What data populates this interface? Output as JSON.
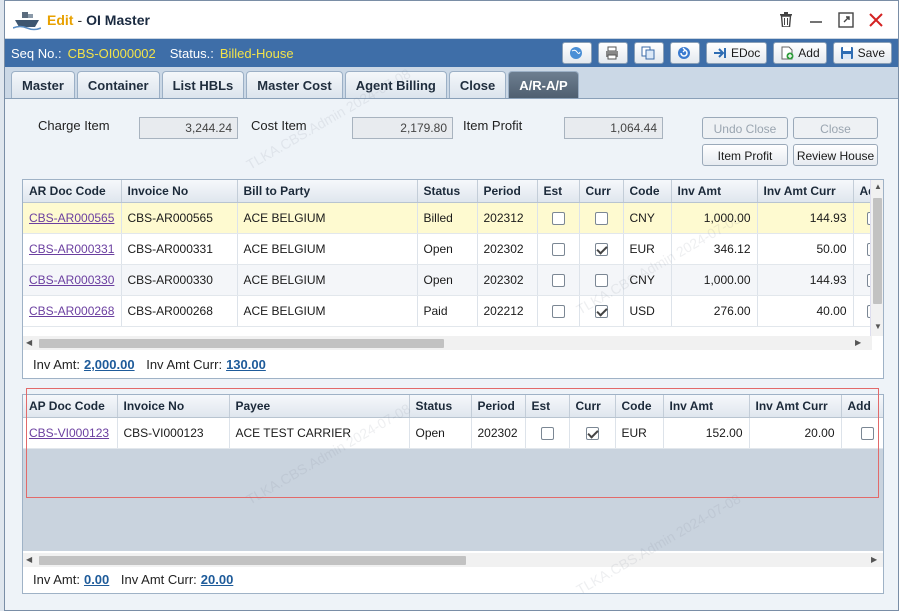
{
  "title": {
    "mode": "Edit",
    "separator": "-",
    "name": "OI Master"
  },
  "info": {
    "seq_label": "Seq No.:",
    "seq_value": "CBS-OI000002",
    "status_label": "Status.:",
    "status_value": "Billed-House"
  },
  "toolbar": {
    "edoc_label": "EDoc",
    "add_label": "Add",
    "save_label": "Save"
  },
  "tabs": [
    "Master",
    "Container",
    "List HBLs",
    "Master Cost",
    "Agent Billing",
    "Close",
    "A/R-A/P"
  ],
  "active_tab": "A/R-A/P",
  "summary": {
    "charge_item_label": "Charge Item",
    "charge_item_value": "3,244.24",
    "cost_item_label": "Cost Item",
    "cost_item_value": "2,179.80",
    "item_profit_label": "Item Profit",
    "item_profit_value": "1,064.44",
    "undo_close_label": "Undo Close",
    "close_label": "Close",
    "item_profit_button": "Item Profit",
    "review_house_button": "Review House"
  },
  "ar": {
    "columns": [
      "AR Doc Code",
      "Invoice No",
      "Bill to Party",
      "Status",
      "Period",
      "Est",
      "Curr",
      "Code",
      "Inv Amt",
      "Inv Amt Curr",
      "Ad"
    ],
    "rows": [
      {
        "doc": "CBS-AR000565",
        "invoice": "CBS-AR000565",
        "party": "ACE BELGIUM",
        "status": "Billed",
        "period": "202312",
        "est": false,
        "curr": false,
        "code": "CNY",
        "amt": "1,000.00",
        "amt_curr": "144.93",
        "ad": false
      },
      {
        "doc": "CBS-AR000331",
        "invoice": "CBS-AR000331",
        "party": "ACE BELGIUM",
        "status": "Open",
        "period": "202302",
        "est": false,
        "curr": true,
        "code": "EUR",
        "amt": "346.12",
        "amt_curr": "50.00",
        "ad": false
      },
      {
        "doc": "CBS-AR000330",
        "invoice": "CBS-AR000330",
        "party": "ACE BELGIUM",
        "status": "Open",
        "period": "202302",
        "est": false,
        "curr": false,
        "code": "CNY",
        "amt": "1,000.00",
        "amt_curr": "144.93",
        "ad": false
      },
      {
        "doc": "CBS-AR000268",
        "invoice": "CBS-AR000268",
        "party": "ACE BELGIUM",
        "status": "Paid",
        "period": "202212",
        "est": false,
        "curr": true,
        "code": "USD",
        "amt": "276.00",
        "amt_curr": "40.00",
        "ad": false
      }
    ],
    "totals": {
      "inv_amt_label": "Inv Amt:",
      "inv_amt": "2,000.00",
      "inv_amt_curr_label": "Inv Amt Curr:",
      "inv_amt_curr": "130.00"
    }
  },
  "ap": {
    "columns": [
      "AP Doc Code",
      "Invoice No",
      "Payee",
      "Status",
      "Period",
      "Est",
      "Curr",
      "Code",
      "Inv Amt",
      "Inv Amt Curr",
      "Add"
    ],
    "rows": [
      {
        "doc": "CBS-VI000123",
        "invoice": "CBS-VI000123",
        "party": "ACE TEST CARRIER",
        "status": "Open",
        "period": "202302",
        "est": false,
        "curr": true,
        "code": "EUR",
        "amt": "152.00",
        "amt_curr": "20.00",
        "ad": false
      }
    ],
    "totals": {
      "inv_amt_label": "Inv Amt:",
      "inv_amt": "0.00",
      "inv_amt_curr_label": "Inv Amt Curr:",
      "inv_amt_curr": "20.00"
    }
  },
  "watermark": "TLKA.CBS.Admin 2024-07-08",
  "colors": {
    "infobar": "#3e6ea8",
    "highlight": "#f2e34a",
    "selected_row": "#fefad0",
    "link": "#6b3fa0",
    "red_outline": "#e26a6a"
  }
}
